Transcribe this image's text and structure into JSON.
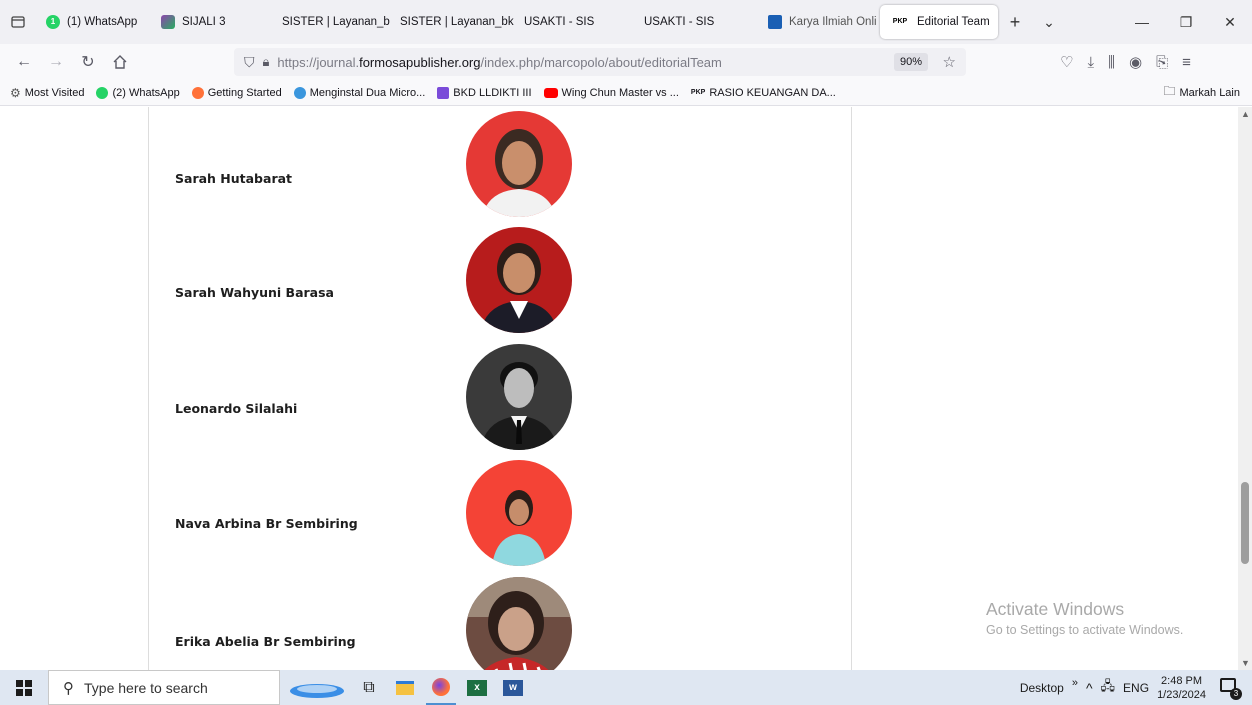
{
  "tabs": [
    {
      "label": "(1) WhatsApp",
      "icon": "whatsapp-badge-icon",
      "color": "#25d366"
    },
    {
      "label": "SIJALI 3",
      "icon": "sijali-icon",
      "color": "#8e44ad"
    },
    {
      "label": "SISTER | Layanan_bkd",
      "icon": "",
      "color": ""
    },
    {
      "label": "SISTER | Layanan_bkd",
      "icon": "",
      "color": ""
    },
    {
      "label": "USAKTI - SIS",
      "icon": "",
      "color": ""
    },
    {
      "label": "USAKTI - SIS",
      "icon": "",
      "color": ""
    },
    {
      "label": "Karya Ilmiah Onli",
      "icon": "karya-icon",
      "color": "#1a5fb4"
    },
    {
      "label": "Editorial Team",
      "icon": "pkp-icon",
      "color": "#000000",
      "active": true
    }
  ],
  "pkp_icon_text": "PKP",
  "url": {
    "prefix": "https://journal.",
    "domain": "formosapublisher.org",
    "path": "/index.php/marcopolo/about/editorialTeam"
  },
  "zoom": "90%",
  "bookmarks": [
    {
      "label": "Most Visited",
      "icon": "gear-icon",
      "color": "#555555"
    },
    {
      "label": "(2) WhatsApp",
      "icon": "whatsapp-icon",
      "color": "#25d366"
    },
    {
      "label": "Getting Started",
      "icon": "firefox-icon",
      "color": "#ff7139"
    },
    {
      "label": "Menginstal Dua Micro...",
      "icon": "microsoft-icon",
      "color": "#3a96dd"
    },
    {
      "label": "BKD LLDIKTI III",
      "icon": "bkd-icon",
      "color": "#7a4bd9"
    },
    {
      "label": "Wing Chun Master vs ...",
      "icon": "youtube-icon",
      "color": "#ff0000"
    },
    {
      "label": "RASIO KEUANGAN DA...",
      "icon": "pkp-icon",
      "color": "#000000"
    }
  ],
  "other_bookmarks": "Markah Lain",
  "people": [
    {
      "name": "Sarah Hutabarat",
      "bg": "#e53935"
    },
    {
      "name": "Sarah Wahyuni Barasa",
      "bg": "#b71c1c"
    },
    {
      "name": "Leonardo Silalahi",
      "bg": "#3a3a3a"
    },
    {
      "name": "Nava Arbina Br Sembiring",
      "bg": "#f44336"
    },
    {
      "name": "Erika Abelia Br Sembiring",
      "bg": "#8d6e63"
    }
  ],
  "watermark": {
    "title": "Activate Windows",
    "subtitle": "Go to Settings to activate Windows."
  },
  "taskbar": {
    "search_placeholder": "Type here to search",
    "desktop_label": "Desktop",
    "lang": "ENG",
    "time": "2:48 PM",
    "date": "1/23/2024",
    "notif_count": "3"
  }
}
